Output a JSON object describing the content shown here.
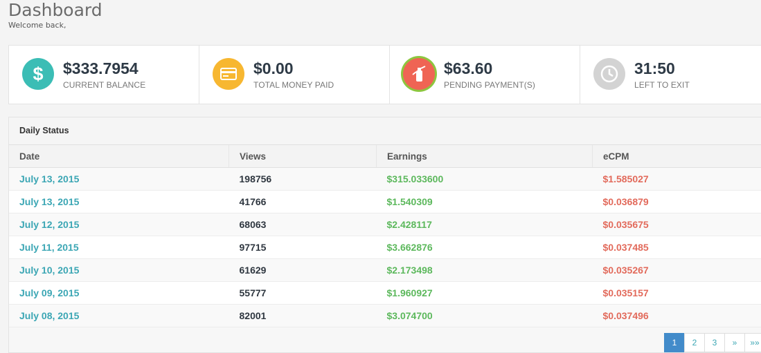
{
  "header": {
    "title": "Dashboard",
    "subtitle": "Welcome back,"
  },
  "stats": [
    {
      "value": "$333.7954",
      "label": "CURRENT BALANCE",
      "icon": "dollar-icon",
      "color": "#3bbdb5"
    },
    {
      "value": "$0.00",
      "label": "TOTAL MONEY PAID",
      "icon": "credit-card-icon",
      "color": "#f7b731"
    },
    {
      "value": "$63.60",
      "label": "PENDING PAYMENT(S)",
      "icon": "fire-extinguisher-icon",
      "color": "#ef6454"
    },
    {
      "value": "31:50",
      "label": "LEFT TO EXIT",
      "icon": "clock-icon",
      "color": "#d3d3d3"
    }
  ],
  "panel": {
    "title": "Daily Status"
  },
  "table": {
    "columns": [
      "Date",
      "Views",
      "Earnings",
      "eCPM"
    ],
    "rows": [
      [
        "July 13, 2015",
        "198756",
        "$315.033600",
        "$1.585027"
      ],
      [
        "July 13, 2015",
        "41766",
        "$1.540309",
        "$0.036879"
      ],
      [
        "July 12, 2015",
        "68063",
        "$2.428117",
        "$0.035675"
      ],
      [
        "July 11, 2015",
        "97715",
        "$3.662876",
        "$0.037485"
      ],
      [
        "July 10, 2015",
        "61629",
        "$2.173498",
        "$0.035267"
      ],
      [
        "July 09, 2015",
        "55777",
        "$1.960927",
        "$0.035157"
      ],
      [
        "July 08, 2015",
        "82001",
        "$3.074700",
        "$0.037496"
      ]
    ]
  },
  "pagination": {
    "pages": [
      "1",
      "2",
      "3"
    ],
    "next": "»",
    "last": "»»",
    "active": "1"
  }
}
